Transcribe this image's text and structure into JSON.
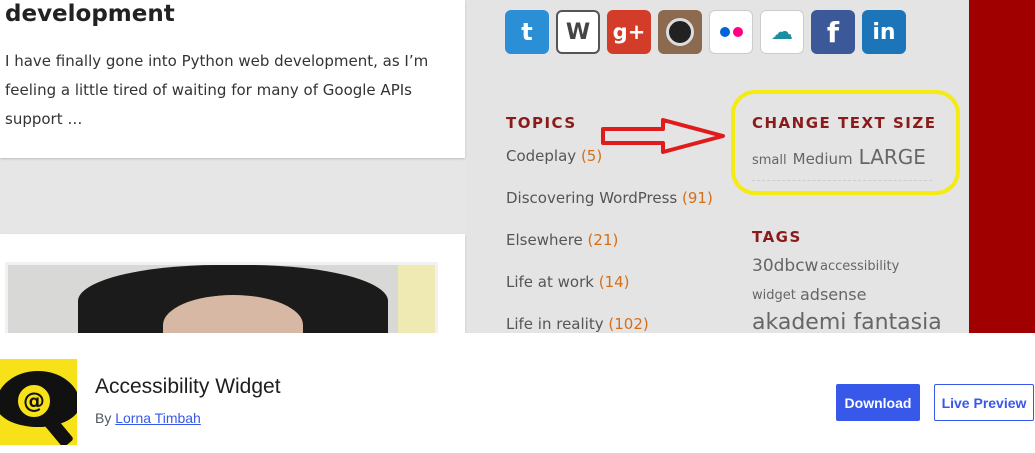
{
  "screenshot": {
    "post": {
      "title": "development",
      "excerpt": "I have finally gone into Python web development, as I’m feeling a little tired of waiting for many of Google APIs support …"
    },
    "social_icons": [
      "twitter-icon",
      "wordpress-icon",
      "google-plus-icon",
      "instagram-icon",
      "flickr-icon",
      "cloud-icon",
      "facebook-icon",
      "linkedin-icon"
    ],
    "topics": {
      "heading": "TOPICS",
      "items": [
        {
          "name": "Codeplay",
          "count": "(5)"
        },
        {
          "name": "Discovering WordPress",
          "count": "(91)"
        },
        {
          "name": "Elsewhere",
          "count": "(21)"
        },
        {
          "name": "Life at work",
          "count": "(14)"
        },
        {
          "name": "Life in reality",
          "count": "(102)"
        }
      ]
    },
    "text_size": {
      "heading": "CHANGE TEXT SIZE",
      "small": "small",
      "medium": "Medium",
      "large": "LARGE"
    },
    "tags": {
      "heading": "TAGS",
      "items": [
        "30dbcw",
        "accessibility",
        "widget",
        "adsense",
        "akademi fantasia"
      ]
    },
    "colors": {
      "highlight_ring": "#f3eb12",
      "arrow": "#e01b1b",
      "accent": "#3858e9"
    }
  },
  "plugin": {
    "name": "Accessibility Widget",
    "by": "By",
    "author": "Lorna Timbah",
    "download_label": "Download",
    "preview_label": "Live Preview"
  }
}
